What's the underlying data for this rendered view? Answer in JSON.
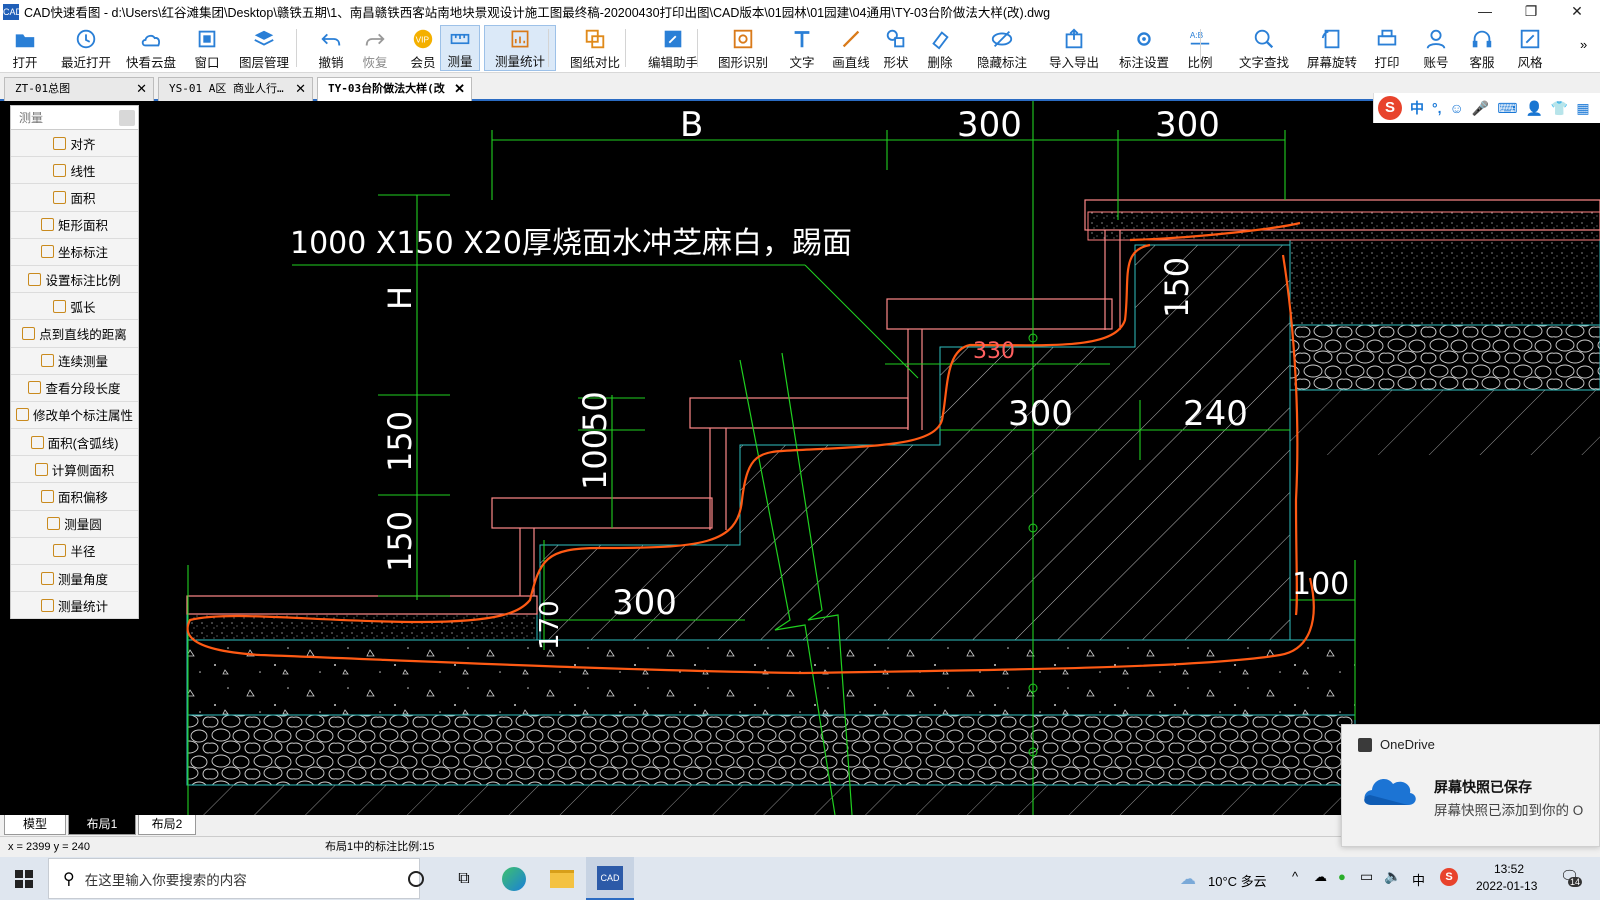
{
  "window": {
    "title": "CAD快速看图 - d:\\Users\\红谷滩集团\\Desktop\\赣铁五期\\1、南昌赣铁西客站南地块景观设计施工图最终稿-20200430打印出图\\CAD版本\\01园林\\01园建\\04通用\\TY-03台阶做法大样(改).dwg",
    "app_icon_text": "CAD"
  },
  "toolbar": [
    {
      "label": "打开",
      "icon": "open-folder-icon"
    },
    {
      "label": "最近打开",
      "icon": "recent-icon"
    },
    {
      "label": "快看云盘",
      "icon": "cloud-icon"
    },
    {
      "label": "窗口",
      "icon": "window-icon"
    },
    {
      "label": "图层管理",
      "icon": "layers-icon"
    },
    {
      "label": "撤销",
      "icon": "undo-icon"
    },
    {
      "label": "恢复",
      "icon": "redo-icon"
    },
    {
      "label": "会员",
      "icon": "vip-icon"
    },
    {
      "label": "测量",
      "icon": "measure-icon"
    },
    {
      "label": "测量统计",
      "icon": "measure-stats-icon"
    },
    {
      "label": "图纸对比",
      "icon": "compare-icon"
    },
    {
      "label": "编辑助手",
      "icon": "edit-helper-icon"
    },
    {
      "label": "图形识别",
      "icon": "shape-recognize-icon"
    },
    {
      "label": "文字",
      "icon": "text-icon"
    },
    {
      "label": "画直线",
      "icon": "line-icon"
    },
    {
      "label": "形状",
      "icon": "shape-icon"
    },
    {
      "label": "删除",
      "icon": "eraser-icon"
    },
    {
      "label": "隐藏标注",
      "icon": "hide-icon"
    },
    {
      "label": "导入导出",
      "icon": "import-export-icon"
    },
    {
      "label": "标注设置",
      "icon": "annotation-settings-icon"
    },
    {
      "label": "比例",
      "icon": "scale-icon"
    },
    {
      "label": "文字查找",
      "icon": "text-search-icon"
    },
    {
      "label": "屏幕旋转",
      "icon": "rotate-icon"
    },
    {
      "label": "打印",
      "icon": "print-icon"
    },
    {
      "label": "账号",
      "icon": "account-icon"
    },
    {
      "label": "客服",
      "icon": "headset-icon"
    },
    {
      "label": "风格",
      "icon": "style-icon"
    }
  ],
  "tabs": [
    {
      "label": "ZT-01总图"
    },
    {
      "label": "YS-01 A区 商业人行…"
    },
    {
      "label": "TY-03台阶做法大样(改"
    }
  ],
  "measure_panel": {
    "search_placeholder": "测量",
    "items": [
      "对齐",
      "线性",
      "面积",
      "矩形面积",
      "坐标标注",
      "设置标注比例",
      "弧长",
      "点到直线的距离",
      "连续测量",
      "查看分段长度",
      "修改单个标注属性",
      "面积(含弧线)",
      "计算侧面积",
      "面积偏移",
      "测量圆",
      "半径",
      "测量角度",
      "测量统计"
    ]
  },
  "drawing": {
    "label_material": "1000 X150 X20厚烧面水冲芝麻白，踢面",
    "dims": [
      "B",
      "300",
      "300",
      "H",
      "150",
      "150",
      "100",
      "50",
      "150",
      "330",
      "300",
      "240",
      "300",
      "170",
      "100"
    ]
  },
  "ime_tray": {
    "lang": "中"
  },
  "layout_tabs": [
    "模型",
    "布局1",
    "布局2"
  ],
  "status": {
    "coords": "x = 2399  y = 240",
    "scale_text": "布局1中的标注比例:15"
  },
  "toast": {
    "app": "OneDrive",
    "title": "屏幕快照已保存",
    "body": "屏幕快照已添加到你的 O"
  },
  "taskbar": {
    "search_placeholder": "在这里输入你要搜索的内容",
    "weather": "10°C 多云",
    "time": "13:52",
    "date": "2022-01-13",
    "ime": "中",
    "notif_count": "14"
  }
}
